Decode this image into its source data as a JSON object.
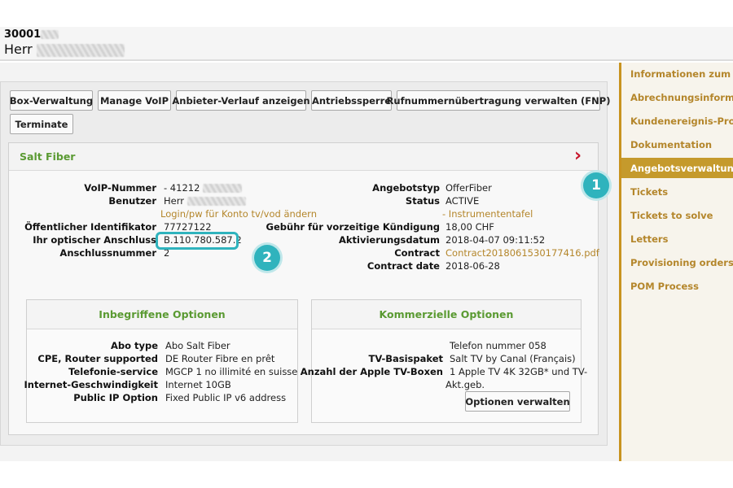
{
  "customer": {
    "id": "30001",
    "salutation": "Herr"
  },
  "toolbar": {
    "box_management": "Box-Verwaltung",
    "manage_voip": "Manage VoIP",
    "provider_history": "Anbieter-Verlauf anzeigen",
    "drive_lock": "Antriebssperre",
    "number_porting": "Rufnummernübertragung verwalten (FNP)",
    "terminate": "Terminate"
  },
  "product": {
    "title": "Salt Fiber",
    "left_fields": {
      "voip_label": "VoIP-Nummer",
      "voip_value": "- 41212",
      "user_label": "Benutzer",
      "user_value": "Herr",
      "login_link": "Login/pw für Konto tv/vod ändern",
      "public_id_label": "Öffentlicher Identifikator",
      "public_id_value": "77727122",
      "optical_label": "Ihr optischer Anschluss",
      "optical_value": "B.110.780.587.2",
      "conn_number_label": "Anschlussnummer",
      "conn_number_value": "2"
    },
    "right_fields": {
      "offer_type_label": "Angebotstyp",
      "offer_type_value": "OfferFiber",
      "status_label": "Status",
      "status_value": "ACTIVE",
      "dashboard_link": "- Instrumententafel",
      "fee_label": "Gebühr für vorzeitige Kündigung",
      "fee_value": "18,00 CHF",
      "activation_label": "Aktivierungsdatum",
      "activation_value": "2018-04-07 09:11:52",
      "contract_label": "Contract",
      "contract_value": "Contract2018061530177416.pdf",
      "contract_date_label": "Contract date",
      "contract_date_value": "2018-06-28"
    }
  },
  "included_options": {
    "title": "Inbegriffene Optionen",
    "rows": [
      {
        "label": "Abo type",
        "value": "Abo Salt Fiber"
      },
      {
        "label": "CPE, Router supported",
        "value": "DE Router Fibre en prêt"
      },
      {
        "label": "Telefonie-service",
        "value": "MGCP 1 no illimité en suisse"
      },
      {
        "label": "Internet-Geschwindigkeit",
        "value": "Internet 10GB"
      },
      {
        "label": "Public IP Option",
        "value": "Fixed Public IP v6 address"
      }
    ]
  },
  "commercial_options": {
    "title": "Kommerzielle Optionen",
    "phone_number": "Telefon nummer 058",
    "tv_label": "TV-Basispaket",
    "tv_value": "Salt TV by Canal (Français)",
    "apple_label": "Anzahl der Apple TV-Boxen",
    "apple_value_line1": "1 Apple TV 4K 32GB* und TV-",
    "apple_value_line2": "Akt.geb.",
    "manage_button": "Optionen verwalten"
  },
  "sidebar": {
    "items": [
      {
        "label": "Informationen zum A..."
      },
      {
        "label": "Abrechnungsinforma..."
      },
      {
        "label": "Kundenereignis-Prot..."
      },
      {
        "label": "Dokumentation"
      },
      {
        "label": "Angebotsverwaltung"
      },
      {
        "label": "Tickets"
      },
      {
        "label": "Tickets to solve"
      },
      {
        "label": "Letters"
      },
      {
        "label": "Provisioning orders"
      },
      {
        "label": "POM Process"
      }
    ]
  },
  "markers": {
    "one": "1",
    "two": "2"
  },
  "colors": {
    "accent_gold": "#c59a2c",
    "link_gold": "#b4862b",
    "green_title": "#5a9a32",
    "marker_teal": "#2fb3bd",
    "chevron_red": "#c7162b"
  }
}
